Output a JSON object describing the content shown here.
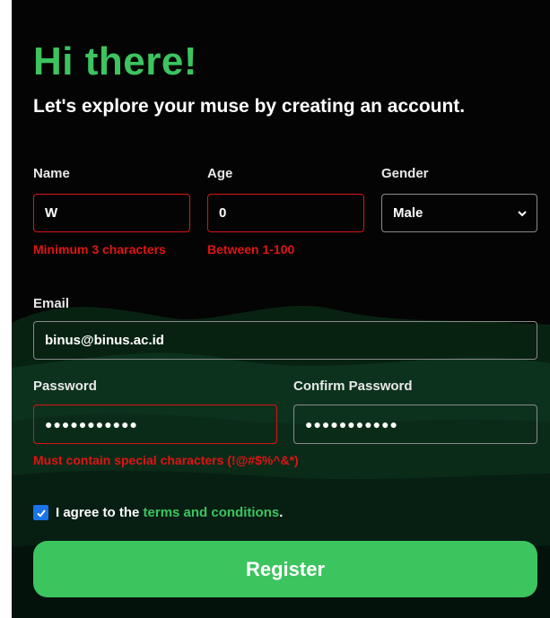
{
  "header": {
    "title": "Hi there!",
    "subtitle": "Let's explore your muse by creating an account."
  },
  "form": {
    "name": {
      "label": "Name",
      "value": "W",
      "error": "Minimum 3 characters"
    },
    "age": {
      "label": "Age",
      "value": "0",
      "error": "Between 1-100"
    },
    "gender": {
      "label": "Gender",
      "selected": "Male"
    },
    "email": {
      "label": "Email",
      "value": "binus@binus.ac.id"
    },
    "password": {
      "label": "Password",
      "value": "●●●●●●●●●●●",
      "error": "Must contain special characters (!@#$%^&*)"
    },
    "confirm_password": {
      "label": "Confirm Password",
      "value": "●●●●●●●●●●●"
    },
    "agree": {
      "prefix": "I agree to the ",
      "link": "terms and conditions",
      "suffix": ".",
      "checked": true
    },
    "register_label": "Register"
  },
  "colors": {
    "accent": "#3cc45f",
    "error": "#d81515",
    "background": "#040404",
    "checkbox": "#1a73e8"
  }
}
